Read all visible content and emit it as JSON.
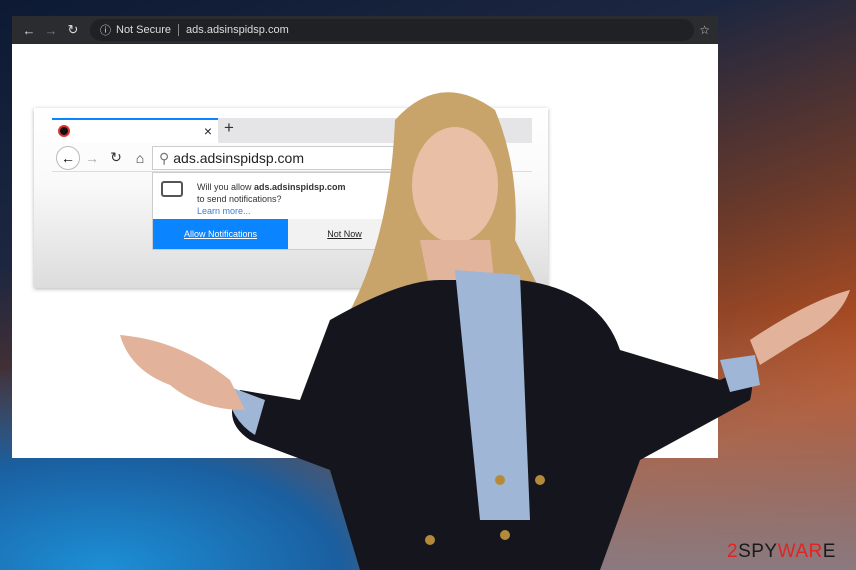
{
  "browser": {
    "back_icon": "arrow-left-icon",
    "forward_icon": "arrow-right-icon",
    "reload_icon": "reload-icon",
    "security_label": "Not Secure",
    "url": "ads.adsinspidsp.com",
    "bookmark_icon": "star-icon"
  },
  "inner_browser": {
    "tab_close": "×",
    "new_tab": "+",
    "url": "ads.adsinspidsp.com",
    "popup": {
      "message_prefix": "Will you allow ",
      "site": "ads.adsinspidsp.com",
      "message_suffix": "to send notifications?",
      "learn_more": "Learn more...",
      "allow_button": "Allow Notifications",
      "deny_button": "Not Now"
    }
  },
  "watermark": {
    "prefix": "2",
    "mid": "SPY",
    "end": "WAR",
    "tail": "E"
  },
  "colors": {
    "accent": "#0a84ff",
    "logo_red": "#e32222"
  }
}
